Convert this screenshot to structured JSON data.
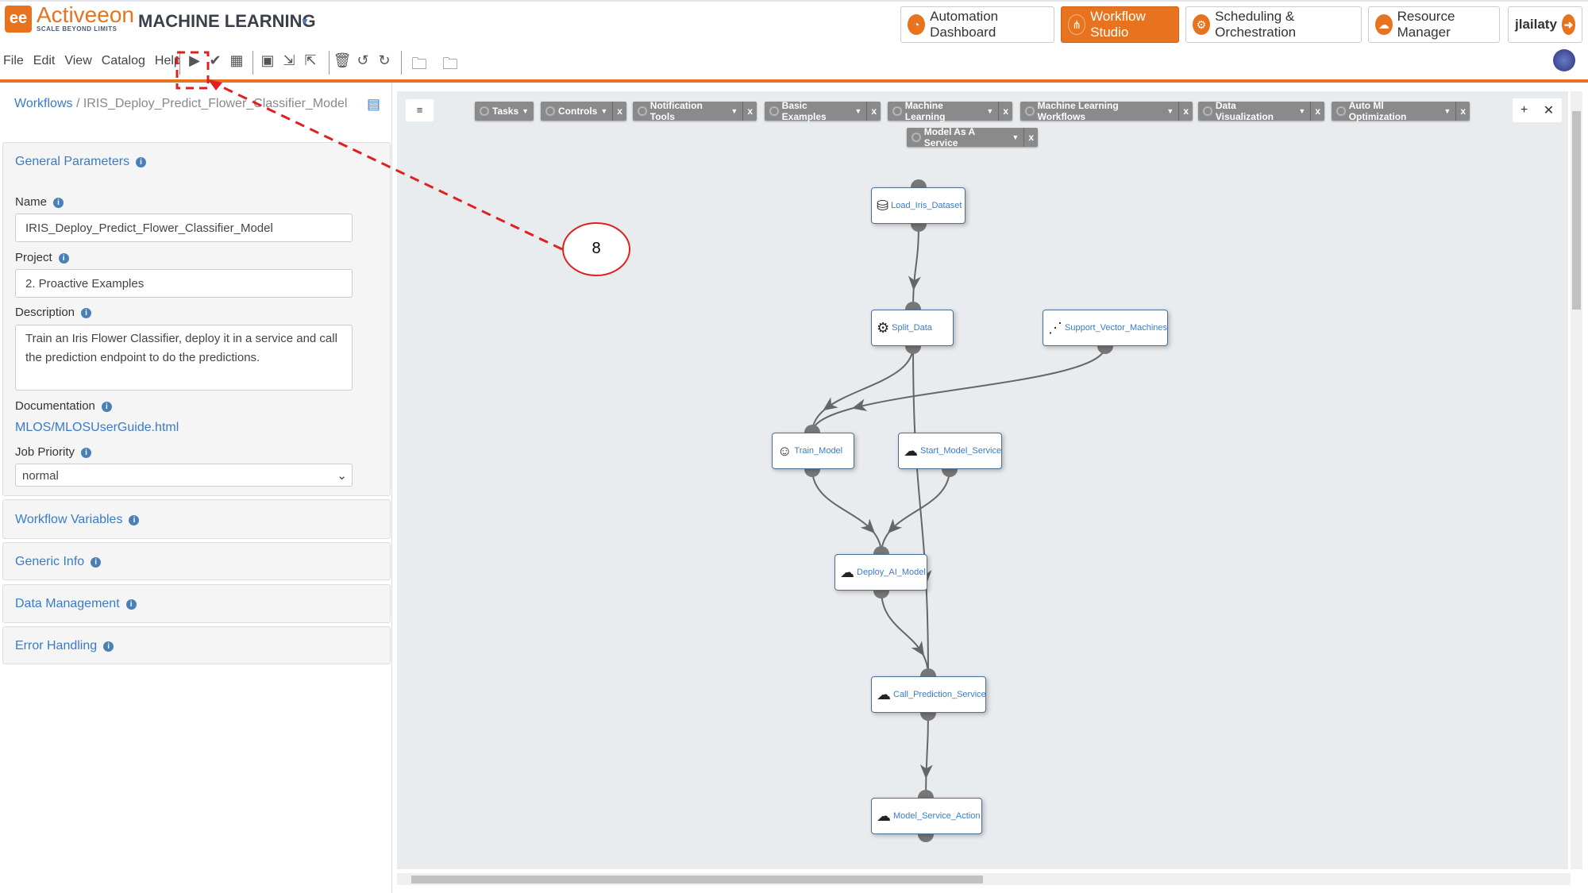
{
  "header": {
    "logo": "Activeeon",
    "logo_tagline": "SCALE BEYOND LIMITS",
    "app_title": "MACHINE LEARNING",
    "nav": [
      {
        "label": "Automation Dashboard",
        "icon": "gauge-icon"
      },
      {
        "label": "Workflow Studio",
        "icon": "workflow-icon",
        "active": true
      },
      {
        "label": "Scheduling & Orchestration",
        "icon": "gears-icon"
      },
      {
        "label": "Resource Manager",
        "icon": "cloud-icon"
      }
    ],
    "user": "jlailaty"
  },
  "menu": [
    "File",
    "Edit",
    "View",
    "Catalog",
    "Help"
  ],
  "toolbar": [
    "play-icon",
    "check-icon",
    "calendar-icon",
    "save-icon",
    "import-icon",
    "export-icon",
    "trash-icon",
    "undo-icon",
    "redo-icon",
    "globe-folder-icon",
    "user-folder-icon"
  ],
  "breadcrumb": {
    "root": "Workflows",
    "current": "IRIS_Deploy_Predict_Flower_Classifier_Model"
  },
  "general": {
    "title": "General Parameters",
    "name_label": "Name",
    "name": "IRIS_Deploy_Predict_Flower_Classifier_Model",
    "project_label": "Project",
    "project": "2. Proactive Examples",
    "description_label": "Description",
    "description": "Train an Iris Flower Classifier, deploy it in a service and call the prediction endpoint to do the predictions.",
    "doc_label": "Documentation",
    "doc_link": "MLOS/MLOSUserGuide.html",
    "priority_label": "Job Priority",
    "priority": "normal"
  },
  "sections": [
    "Workflow Variables",
    "Generic Info",
    "Data Management",
    "Error Handling"
  ],
  "buckets": [
    "Tasks",
    "Controls",
    "Notification Tools",
    "Basic Examples",
    "Machine Learning",
    "Machine Learning Workflows",
    "Data Visualization",
    "Auto Ml Optimization",
    "Model As A Service"
  ],
  "nodes": [
    "Load_Iris_Dataset",
    "Split_Data",
    "Support_Vector_Machines",
    "Train_Model",
    "Start_Model_Service",
    "Deploy_AI_Model",
    "Call_Prediction_Service",
    "Model_Service_Action"
  ],
  "edges": [
    [
      0,
      1
    ],
    [
      1,
      3
    ],
    [
      2,
      3
    ],
    [
      1,
      6
    ],
    [
      3,
      5
    ],
    [
      4,
      5
    ],
    [
      5,
      6
    ],
    [
      6,
      7
    ]
  ],
  "annotation": {
    "step": "8",
    "color": "#e02020"
  },
  "colors": {
    "accent": "#e8731f",
    "link": "#3a7bc8"
  }
}
